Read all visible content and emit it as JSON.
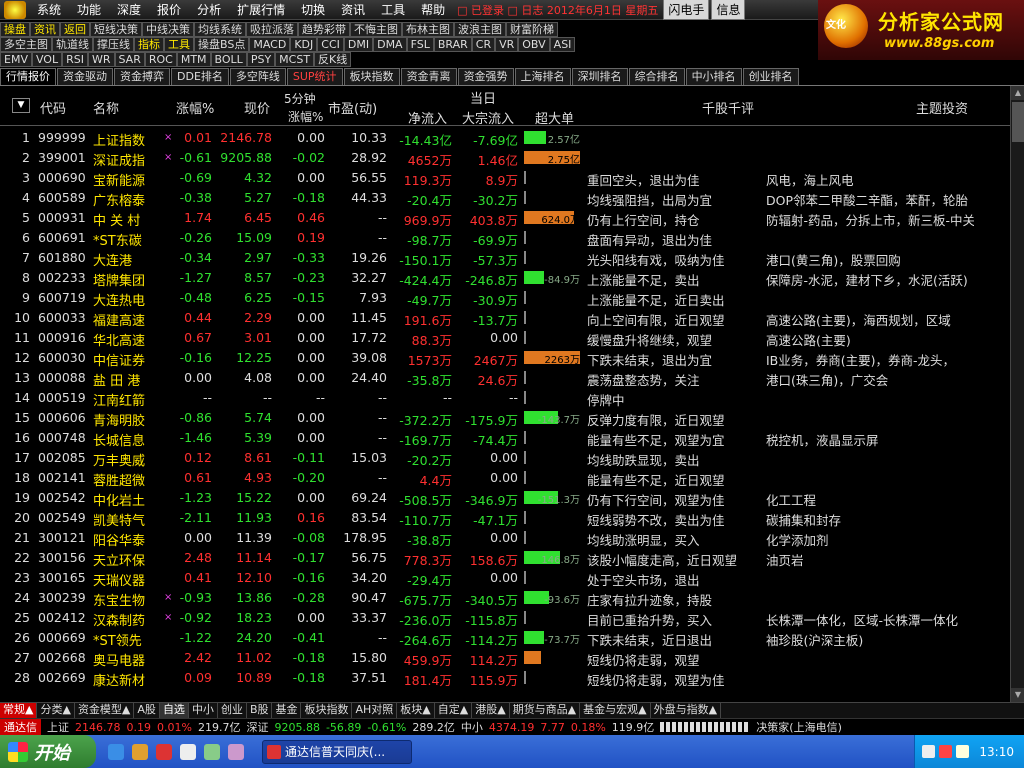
{
  "menu": {
    "items": [
      "系统",
      "功能",
      "深度",
      "报价",
      "分析",
      "扩展行情",
      "切换",
      "资讯",
      "工具",
      "帮助"
    ],
    "login_text": "□ 已登录 □ 日志 2012年6月1日 星期五",
    "flash_buttons": [
      "闪电手",
      "信息"
    ]
  },
  "brand": {
    "logo_text": "文化",
    "title": "分析家公式网",
    "url": "www.88gs.com"
  },
  "toolbar": {
    "row1": [
      "操盘",
      "资讯",
      "返回",
      "短线决策",
      "中线决策",
      "均线系统",
      "吸拉派落",
      "趋势彩带",
      "不悔主图",
      "布林主图",
      "波浪主图",
      "财富阶梯"
    ],
    "row2": [
      "多空主图",
      "轨道线",
      "撑压线",
      "指标",
      "工具",
      "操盘BS点",
      "MACD",
      "KDJ",
      "CCI",
      "DMI",
      "DMA",
      "FSL",
      "BRAR",
      "CR",
      "VR",
      "OBV",
      "ASI"
    ],
    "row3": [
      "EMV",
      "VOL",
      "RSI",
      "WR",
      "SAR",
      "ROC",
      "MTM",
      "BOLL",
      "PSY",
      "MCST",
      "反K线"
    ]
  },
  "tabs": [
    "行情报价",
    "资金驱动",
    "资金搏弈",
    "DDE排名",
    "多空阵线",
    "SUP统计",
    "板块指数",
    "资金青离",
    "资金强势",
    "上海排名",
    "深圳排名",
    "综合排名",
    "中小排名",
    "创业排名"
  ],
  "columns": {
    "code": "代码",
    "name": "名称",
    "pct": "涨幅%",
    "price": "现价",
    "m5_top": "5分钟",
    "m5_bot": "涨幅%",
    "pe": "市盈(动)",
    "today": "当日",
    "in": "净流入",
    "blk": "大宗流入",
    "big": "超大单",
    "comment": "千股千评",
    "theme": "主题投资"
  },
  "rows": [
    {
      "n": "1",
      "code": "999999",
      "name": "上证指数",
      "mark": "×",
      "pct": "0.01",
      "price": "2146.78",
      "m5": "0.00",
      "pe": "10.33",
      "inflow": "-14.43亿",
      "blk": "-7.69亿",
      "big": "2.57亿",
      "big_dir": "up",
      "big_len": 0.4,
      "comment": "",
      "theme": ""
    },
    {
      "n": "2",
      "code": "399001",
      "name": "深证成指",
      "mark": "×",
      "pct": "-0.61",
      "price": "9205.88",
      "m5": "-0.02",
      "pe": "28.92",
      "inflow": "4652万",
      "blk": "1.46亿",
      "big": "2.75亿",
      "big_dir": "hot",
      "big_len": 1.0,
      "comment": "",
      "theme": ""
    },
    {
      "n": "3",
      "code": "000690",
      "name": "宝新能源",
      "mark": "",
      "pct": "-0.69",
      "price": "4.32",
      "m5": "0.00",
      "pe": "56.55",
      "inflow": "119.3万",
      "blk": "8.9万",
      "big": "",
      "big_dir": "none",
      "big_len": 0,
      "comment": "重回空头，退出为佳",
      "theme": "风电，海上风电"
    },
    {
      "n": "4",
      "code": "600589",
      "name": "广东榕泰",
      "mark": "",
      "pct": "-0.38",
      "price": "5.27",
      "m5": "-0.18",
      "pe": "44.33",
      "inflow": "-20.4万",
      "blk": "-30.2万",
      "big": "",
      "big_dir": "none",
      "big_len": 0,
      "comment": "均线强阻挡，出局为宜",
      "theme": "DOP邻苯二甲酸二辛酯，苯酐，轮胎"
    },
    {
      "n": "5",
      "code": "000931",
      "name": "中 关 村",
      "mark": "",
      "pct": "1.74",
      "price": "6.45",
      "m5": "0.46",
      "pe": "--",
      "inflow": "969.9万",
      "blk": "403.8万",
      "big": "624.0万",
      "big_dir": "hot",
      "big_len": 0.9,
      "comment": "仍有上行空间，持仓",
      "theme": "防辐射-药品，分拆上市，新三板-中关"
    },
    {
      "n": "6",
      "code": "600691",
      "name": "*ST东碳",
      "mark": "",
      "pct": "-0.26",
      "price": "15.09",
      "m5": "0.19",
      "pe": "--",
      "inflow": "-98.7万",
      "blk": "-69.9万",
      "big": "",
      "big_dir": "none",
      "big_len": 0,
      "comment": "盘面有异动，退出为佳",
      "theme": ""
    },
    {
      "n": "7",
      "code": "601880",
      "name": "大连港",
      "mark": "",
      "pct": "-0.34",
      "price": "2.97",
      "m5": "-0.33",
      "pe": "19.26",
      "inflow": "-150.1万",
      "blk": "-57.3万",
      "big": "",
      "big_dir": "none",
      "big_len": 0,
      "comment": "光头阳线有戏，吸纳为佳",
      "theme": "港口(黄三角)，股票回购"
    },
    {
      "n": "8",
      "code": "002233",
      "name": "塔牌集团",
      "mark": "",
      "pct": "-1.27",
      "price": "8.57",
      "m5": "-0.23",
      "pe": "32.27",
      "inflow": "-424.4万",
      "blk": "-246.8万",
      "big": "-84.9万",
      "big_dir": "down",
      "big_len": 0.35,
      "comment": "上涨能量不足，卖出",
      "theme": "保障房-水泥，建材下乡，水泥(活跃)"
    },
    {
      "n": "9",
      "code": "600719",
      "name": "大连热电",
      "mark": "",
      "pct": "-0.48",
      "price": "6.25",
      "m5": "-0.15",
      "pe": "7.93",
      "inflow": "-49.7万",
      "blk": "-30.9万",
      "big": "",
      "big_dir": "none",
      "big_len": 0,
      "comment": "上涨能量不足，近日卖出",
      "theme": ""
    },
    {
      "n": "10",
      "code": "600033",
      "name": "福建高速",
      "mark": "",
      "pct": "0.44",
      "price": "2.29",
      "m5": "0.00",
      "pe": "11.45",
      "inflow": "191.6万",
      "blk": "-13.7万",
      "big": "",
      "big_dir": "none",
      "big_len": 0,
      "comment": "向上空间有限，近日观望",
      "theme": "高速公路(主要)，海西规划，区域"
    },
    {
      "n": "11",
      "code": "000916",
      "name": "华北高速",
      "mark": "",
      "pct": "0.67",
      "price": "3.01",
      "m5": "0.00",
      "pe": "17.72",
      "inflow": "88.3万",
      "blk": "0.00",
      "big": "",
      "big_dir": "none",
      "big_len": 0,
      "comment": "缓慢盘升将继续，观望",
      "theme": "高速公路(主要)"
    },
    {
      "n": "12",
      "code": "600030",
      "name": "中信证券",
      "mark": "",
      "pct": "-0.16",
      "price": "12.25",
      "m5": "0.00",
      "pe": "39.08",
      "inflow": "1573万",
      "blk": "2467万",
      "big": "2263万",
      "big_dir": "hot",
      "big_len": 1.0,
      "comment": "下跌未结束，退出为宜",
      "theme": "IB业务，券商(主要)，券商-龙头，"
    },
    {
      "n": "13",
      "code": "000088",
      "name": "盐 田 港",
      "mark": "",
      "pct": "0.00",
      "price": "4.08",
      "m5": "0.00",
      "pe": "24.40",
      "inflow": "-35.8万",
      "blk": "24.6万",
      "big": "",
      "big_dir": "none",
      "big_len": 0,
      "comment": "震荡盘整态势，关注",
      "theme": "港口(珠三角)，广交会"
    },
    {
      "n": "14",
      "code": "000519",
      "name": "江南红箭",
      "mark": "",
      "pct": "--",
      "price": "--",
      "m5": "--",
      "pe": "--",
      "inflow": "--",
      "blk": "--",
      "big": "",
      "big_dir": "none",
      "big_len": 0,
      "comment": "停牌中",
      "theme": ""
    },
    {
      "n": "15",
      "code": "000606",
      "name": "青海明胶",
      "mark": "",
      "pct": "-0.86",
      "price": "5.74",
      "m5": "0.00",
      "pe": "--",
      "inflow": "-372.2万",
      "blk": "-175.9万",
      "big": "-143.7万",
      "big_dir": "down",
      "big_len": 0.6,
      "comment": "反弹力度有限，近日观望",
      "theme": ""
    },
    {
      "n": "16",
      "code": "000748",
      "name": "长城信息",
      "mark": "",
      "pct": "-1.46",
      "price": "5.39",
      "m5": "0.00",
      "pe": "--",
      "inflow": "-169.7万",
      "blk": "-74.4万",
      "big": "",
      "big_dir": "none",
      "big_len": 0,
      "comment": "能量有些不足，观望为宜",
      "theme": "税控机，液晶显示屏"
    },
    {
      "n": "17",
      "code": "002085",
      "name": "万丰奥威",
      "mark": "",
      "pct": "0.12",
      "price": "8.61",
      "m5": "-0.11",
      "pe": "15.03",
      "inflow": "-20.2万",
      "blk": "0.00",
      "big": "",
      "big_dir": "none",
      "big_len": 0,
      "comment": "均线助跌显现，卖出",
      "theme": ""
    },
    {
      "n": "18",
      "code": "002141",
      "name": "蓉胜超微",
      "mark": "",
      "pct": "0.61",
      "price": "4.93",
      "m5": "-0.20",
      "pe": "--",
      "inflow": "4.4万",
      "blk": "0.00",
      "big": "",
      "big_dir": "none",
      "big_len": 0,
      "comment": "能量有些不足，近日观望",
      "theme": ""
    },
    {
      "n": "19",
      "code": "002542",
      "name": "中化岩土",
      "mark": "",
      "pct": "-1.23",
      "price": "15.22",
      "m5": "0.00",
      "pe": "69.24",
      "inflow": "-508.5万",
      "blk": "-346.9万",
      "big": "-151.3万",
      "big_dir": "down",
      "big_len": 0.6,
      "comment": "仍有下行空间，观望为佳",
      "theme": "化工工程"
    },
    {
      "n": "20",
      "code": "002549",
      "name": "凯美特气",
      "mark": "",
      "pct": "-2.11",
      "price": "11.93",
      "m5": "0.16",
      "pe": "83.54",
      "inflow": "-110.7万",
      "blk": "-47.1万",
      "big": "",
      "big_dir": "none",
      "big_len": 0,
      "comment": "短线弱势不改，卖出为佳",
      "theme": "碳捕集和封存"
    },
    {
      "n": "21",
      "code": "300121",
      "name": "阳谷华泰",
      "mark": "",
      "pct": "0.00",
      "price": "11.39",
      "m5": "-0.08",
      "pe": "178.95",
      "inflow": "-38.8万",
      "blk": "0.00",
      "big": "",
      "big_dir": "none",
      "big_len": 0,
      "comment": "均线助涨明显，买入",
      "theme": "化学添加剂"
    },
    {
      "n": "22",
      "code": "300156",
      "name": "天立环保",
      "mark": "",
      "pct": "2.48",
      "price": "11.14",
      "m5": "-0.17",
      "pe": "56.75",
      "inflow": "778.3万",
      "blk": "158.6万",
      "big": "146.8万",
      "big_dir": "up",
      "big_len": 0.65,
      "comment": "该股小幅度走高，近日观望",
      "theme": "油页岩"
    },
    {
      "n": "23",
      "code": "300165",
      "name": "天瑞仪器",
      "mark": "",
      "pct": "0.41",
      "price": "12.10",
      "m5": "-0.16",
      "pe": "34.20",
      "inflow": "-29.4万",
      "blk": "0.00",
      "big": "",
      "big_dir": "none",
      "big_len": 0,
      "comment": "处于空头市场，退出",
      "theme": ""
    },
    {
      "n": "24",
      "code": "300239",
      "name": "东宝生物",
      "mark": "×",
      "pct": "-0.93",
      "price": "13.86",
      "m5": "-0.28",
      "pe": "90.47",
      "inflow": "-675.7万",
      "blk": "-340.5万",
      "big": "-93.6万",
      "big_dir": "down",
      "big_len": 0.45,
      "comment": "庄家有拉升迹象，持股",
      "theme": ""
    },
    {
      "n": "25",
      "code": "002412",
      "name": "汉森制药",
      "mark": "×",
      "pct": "-0.92",
      "price": "18.23",
      "m5": "0.00",
      "pe": "33.37",
      "inflow": "-236.0万",
      "blk": "-115.8万",
      "big": "",
      "big_dir": "none",
      "big_len": 0,
      "comment": "目前已重拾升势，买入",
      "theme": "长株潭一体化，区域-长株潭一体化"
    },
    {
      "n": "26",
      "code": "000669",
      "name": "*ST领先",
      "mark": "",
      "pct": "-1.22",
      "price": "24.20",
      "m5": "-0.41",
      "pe": "--",
      "inflow": "-264.6万",
      "blk": "-114.2万",
      "big": "-73.7万",
      "big_dir": "down",
      "big_len": 0.35,
      "comment": "下跌未结束，近日退出",
      "theme": "袖珍股(沪深主板)"
    },
    {
      "n": "27",
      "code": "002668",
      "name": "奥马电器",
      "mark": "",
      "pct": "2.42",
      "price": "11.02",
      "m5": "-0.18",
      "pe": "15.80",
      "inflow": "459.9万",
      "blk": "114.2万",
      "big": "71.5万",
      "big_dir": "hot",
      "big_len": 0.3,
      "comment": "短线仍将走弱，观望",
      "theme": ""
    },
    {
      "n": "28",
      "code": "002669",
      "name": "康达新材",
      "mark": "",
      "pct": "0.09",
      "price": "10.89",
      "m5": "-0.18",
      "pe": "37.51",
      "inflow": "181.4万",
      "blk": "115.9万",
      "big": "",
      "big_dir": "none",
      "big_len": 0,
      "comment": "短线仍将走弱，观望为佳",
      "theme": ""
    }
  ],
  "bottom_tabs": [
    "常规▲",
    "分类▲",
    "资金模型▲",
    "A股",
    "自选",
    "中小",
    "创业",
    "B股",
    "基金",
    "板块指数",
    "AH对照",
    "板块▲",
    "自定▲",
    "港股▲",
    "期货与商品▲",
    "基金与宏观▲",
    "外盘与指数▲"
  ],
  "status": {
    "brand": "通达信",
    "sh_label": "上证",
    "sh_price": "2146.78",
    "sh_chg": "0.19",
    "sh_pct": "0.01%",
    "sh_amt": "219.7亿",
    "sz_label": "深证",
    "sz_price": "9205.88",
    "sz_chg": "-56.89",
    "sz_pct": "-0.61%",
    "sz_amt": "289.2亿",
    "zx_label": "中小",
    "zx_price": "4374.19",
    "zx_chg": "7.77",
    "zx_pct": "0.18%",
    "zx_amt": "119.9亿",
    "server": "决策家(上海电信)"
  },
  "taskbar": {
    "start": "开始",
    "task": "通达信普天同庆(...",
    "clock": "13:10"
  },
  "colors": {
    "up": "#ff3030",
    "down": "#30e030",
    "hot": "#e07820"
  }
}
